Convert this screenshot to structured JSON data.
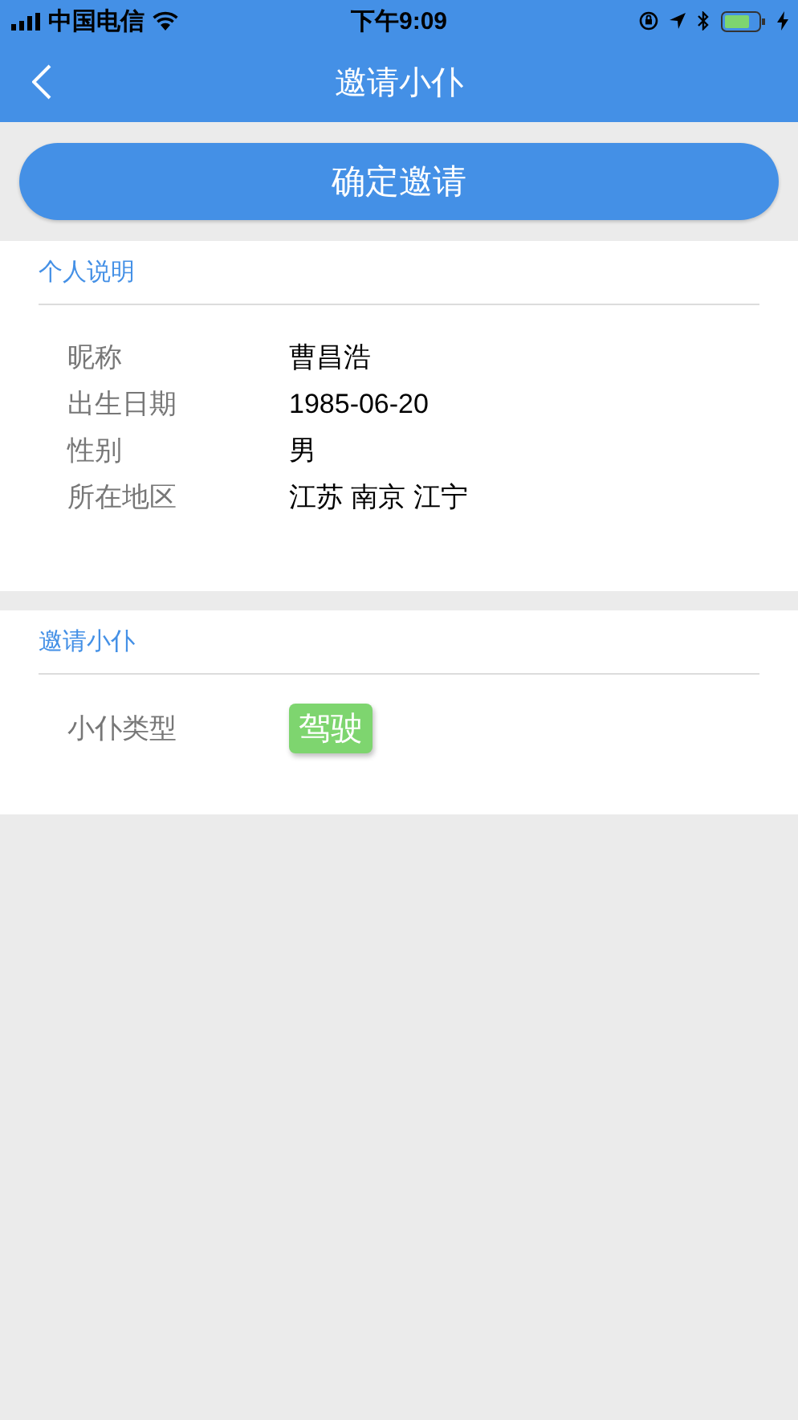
{
  "status_bar": {
    "carrier": "中国电信",
    "time": "下午9:09"
  },
  "nav": {
    "title": "邀请小仆"
  },
  "confirm_button": {
    "label": "确定邀请"
  },
  "sections": [
    {
      "title": "个人说明",
      "rows": [
        {
          "kind": "text",
          "label": "昵称",
          "value": "曹昌浩"
        },
        {
          "kind": "text",
          "label": "出生日期",
          "value": "1985-06-20"
        },
        {
          "kind": "text",
          "label": "性别",
          "value": "男"
        },
        {
          "kind": "text",
          "label": "所在地区",
          "value": "江苏 南京 江宁"
        }
      ]
    },
    {
      "title": "邀请小仆",
      "rows": [
        {
          "kind": "tag",
          "label": "小仆类型",
          "value": "驾驶",
          "color": "#7ed56f"
        }
      ]
    }
  ]
}
